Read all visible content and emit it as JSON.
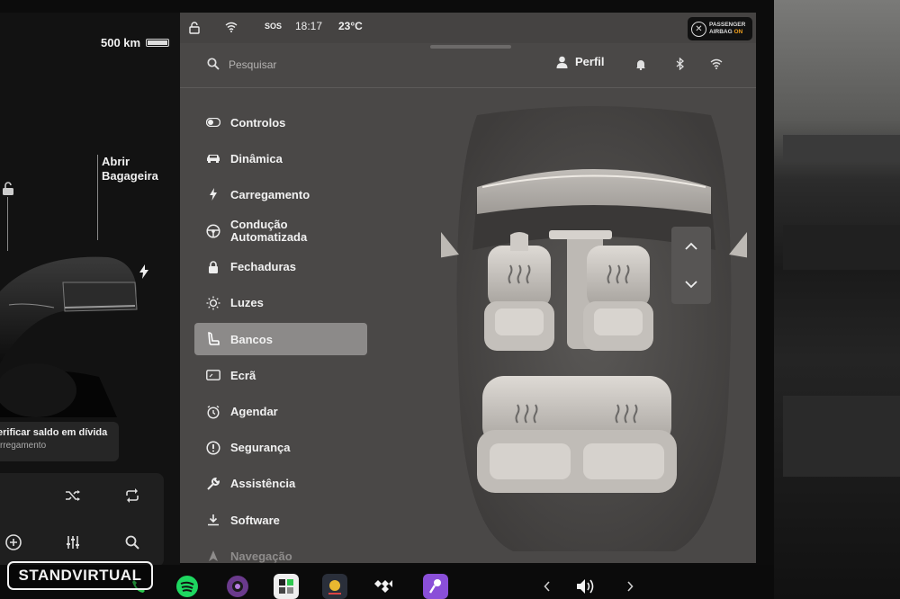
{
  "car": {
    "range": "500 km",
    "trunk_label_line1": "Abrir",
    "trunk_label_line2": "Bagageira",
    "alert_line1": "erificar saldo em dívida",
    "alert_line2": "rregamento"
  },
  "status_bar": {
    "sos": "SOS",
    "time": "18:17",
    "temperature": "23°C",
    "airbag_line1": "PASSENGER",
    "airbag_line2": "AIRBAG",
    "airbag_state": "ON"
  },
  "search": {
    "placeholder": "Pesquisar"
  },
  "header": {
    "profile_label": "Perfil"
  },
  "menu": {
    "items": [
      {
        "label": "Controlos",
        "icon": "toggle-icon"
      },
      {
        "label": "Dinâmica",
        "icon": "car-icon"
      },
      {
        "label": "Carregamento",
        "icon": "bolt-icon"
      },
      {
        "label": "Condução Automatizada",
        "line1": "Condução",
        "line2": "Automatizada",
        "icon": "steering-wheel-icon"
      },
      {
        "label": "Fechaduras",
        "icon": "lock-icon"
      },
      {
        "label": "Luzes",
        "icon": "sun-icon"
      },
      {
        "label": "Bancos",
        "icon": "seat-icon",
        "active": true
      },
      {
        "label": "Ecrã",
        "icon": "display-icon"
      },
      {
        "label": "Agendar",
        "icon": "alarm-clock-icon"
      },
      {
        "label": "Segurança",
        "icon": "alert-circle-icon"
      },
      {
        "label": "Assistência",
        "icon": "wrench-icon"
      },
      {
        "label": "Software",
        "icon": "download-icon"
      },
      {
        "label": "Navegação",
        "icon": "navigation-icon"
      }
    ]
  },
  "taskbar": {
    "watermark": "STANDVIRTUAL"
  },
  "colors": {
    "accent_orange": "#f0a01e",
    "panel_bg": "#4a4847",
    "active_item": "#8c8a89"
  }
}
